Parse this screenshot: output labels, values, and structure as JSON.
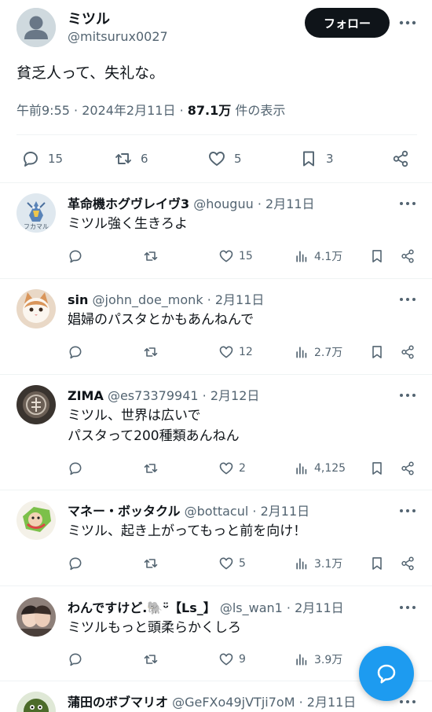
{
  "tweet": {
    "author_name": "ミツル",
    "author_handle": "@mitsurux0027",
    "follow_label": "フォロー",
    "text": "貧乏人って、失礼な。",
    "time": "午前9:55",
    "date": "2024年2月11日",
    "views_count": "87.1万",
    "views_label": "件の表示",
    "replies": "15",
    "retweets": "6",
    "likes": "5",
    "bookmarks": "3"
  },
  "replies": [
    {
      "name": "革命機ホグヴレイヴ3",
      "handle": "@houguu",
      "date": "2月11日",
      "lines": [
        "ミツル強く生きろよ"
      ],
      "likes": "15",
      "views": "4.1万",
      "avatar_label": "フカマル",
      "avatar_color": "#dfe8ef"
    },
    {
      "name": "sin",
      "handle": "@john_doe_monk",
      "date": "2月11日",
      "lines": [
        "娼婦のパスタとかもあんねんで"
      ],
      "likes": "12",
      "views": "2.7万",
      "avatar_color": "#e9d8c6"
    },
    {
      "name": "ZIMA",
      "handle": "@es73379941",
      "date": "2月12日",
      "lines": [
        "ミツル、世界は広いで",
        "パスタって200種類あんねん"
      ],
      "likes": "2",
      "views": "4,125",
      "avatar_color": "#3a342f"
    },
    {
      "name": "マネー・ボッタクル",
      "handle": "@bottacul",
      "date": "2月11日",
      "lines": [
        "ミツル、起き上がってもっと前を向け！"
      ],
      "likes": "5",
      "views": "3.1万",
      "avatar_color": "#f4f1e8"
    },
    {
      "name": "わんですけど.🐘ᵕ̈【Ls_】",
      "handle": "@ls_wan1",
      "date": "2月11日",
      "lines": [
        "ミツルもっと頭柔らかくしろ"
      ],
      "likes": "9",
      "views": "3.9万",
      "avatar_color": "#8d7f79"
    },
    {
      "name": "蒲田のボブマリオ",
      "handle": "@GeFXo49jVTji7oM",
      "date": "2月11日",
      "lines": [],
      "likes": "",
      "views": "",
      "avatar_color": "#4c6b2a"
    }
  ],
  "colors": {
    "accent": "#1d9bf0",
    "text": "#0f1419",
    "muted": "#536471",
    "divider": "#eff3f4"
  }
}
